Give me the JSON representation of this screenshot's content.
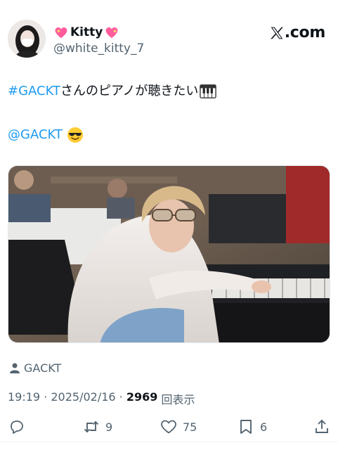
{
  "brand": {
    "text": ".com",
    "logo": "x-logo-icon"
  },
  "user": {
    "display_name": "Kitty",
    "handle": "@white_kitty_7",
    "avatar": "avatar-image",
    "name_icons": [
      "sparkling-heart-icon",
      "sparkling-heart-icon"
    ]
  },
  "tweet": {
    "hashtag": "#GACKT",
    "text": " さんのピアノが聴きたい",
    "mention": "@GACKT",
    "emoji_1": "piano-keys-icon",
    "emoji_2": "smiling-face-with-sunglasses-icon"
  },
  "media": {
    "alt_icon": "photo-image"
  },
  "tagged": {
    "name": "GACKT"
  },
  "meta": {
    "time": "19:19",
    "sep1": " · ",
    "date": "2025/02/16",
    "sep2": " · ",
    "views": "2969",
    "views_label": " 回表示"
  },
  "actions": {
    "reply_count": "",
    "retweet_count": "9",
    "like_count": "75",
    "bookmark_count": "6"
  },
  "colors": {
    "link": "#1d9bf0",
    "muted": "#536471",
    "text": "#0f1419"
  }
}
